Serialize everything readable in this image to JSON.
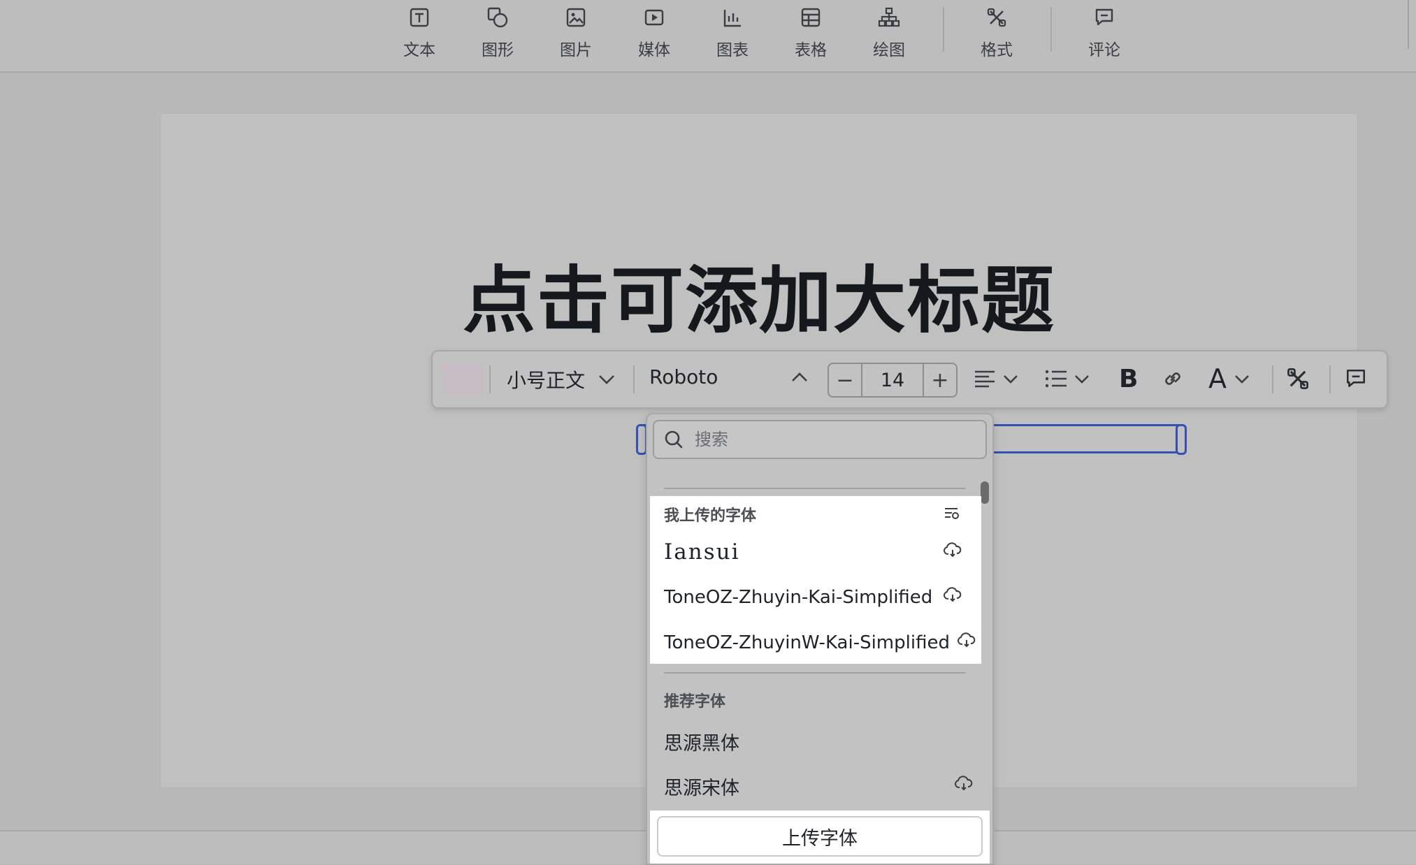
{
  "toolbar": {
    "items": [
      {
        "label": "文本",
        "icon": "text-box-icon"
      },
      {
        "label": "图形",
        "icon": "shapes-icon"
      },
      {
        "label": "图片",
        "icon": "image-icon"
      },
      {
        "label": "媒体",
        "icon": "media-play-icon"
      },
      {
        "label": "图表",
        "icon": "chart-icon"
      },
      {
        "label": "表格",
        "icon": "table-icon"
      },
      {
        "label": "绘图",
        "icon": "diagram-icon"
      },
      {
        "label": "格式",
        "icon": "format-icon"
      },
      {
        "label": "评论",
        "icon": "comment-icon"
      }
    ]
  },
  "slide": {
    "title": "点击可添加大标题"
  },
  "format_bar": {
    "text_style": "小号正文",
    "font_name": "Roboto",
    "font_size": "14",
    "decrease_label": "−",
    "increase_label": "+",
    "bold_label": "B",
    "font_color_label": "A",
    "swatch_color": "#c7bcc4"
  },
  "font_dropdown": {
    "search_placeholder": "搜索",
    "uploaded_header": "我上传的字体",
    "uploaded_fonts": [
      "Iansui",
      "ToneOZ-Zhuyin-Kai-Simplified",
      "ToneOZ-ZhuyinW-Kai-Simplified"
    ],
    "recommended_header": "推荐字体",
    "recommended_fonts": [
      "思源黑体",
      "思源宋体"
    ],
    "upload_button": "上传字体"
  },
  "colors": {
    "accent": "#3451b2",
    "highlight": "#ffffff"
  }
}
